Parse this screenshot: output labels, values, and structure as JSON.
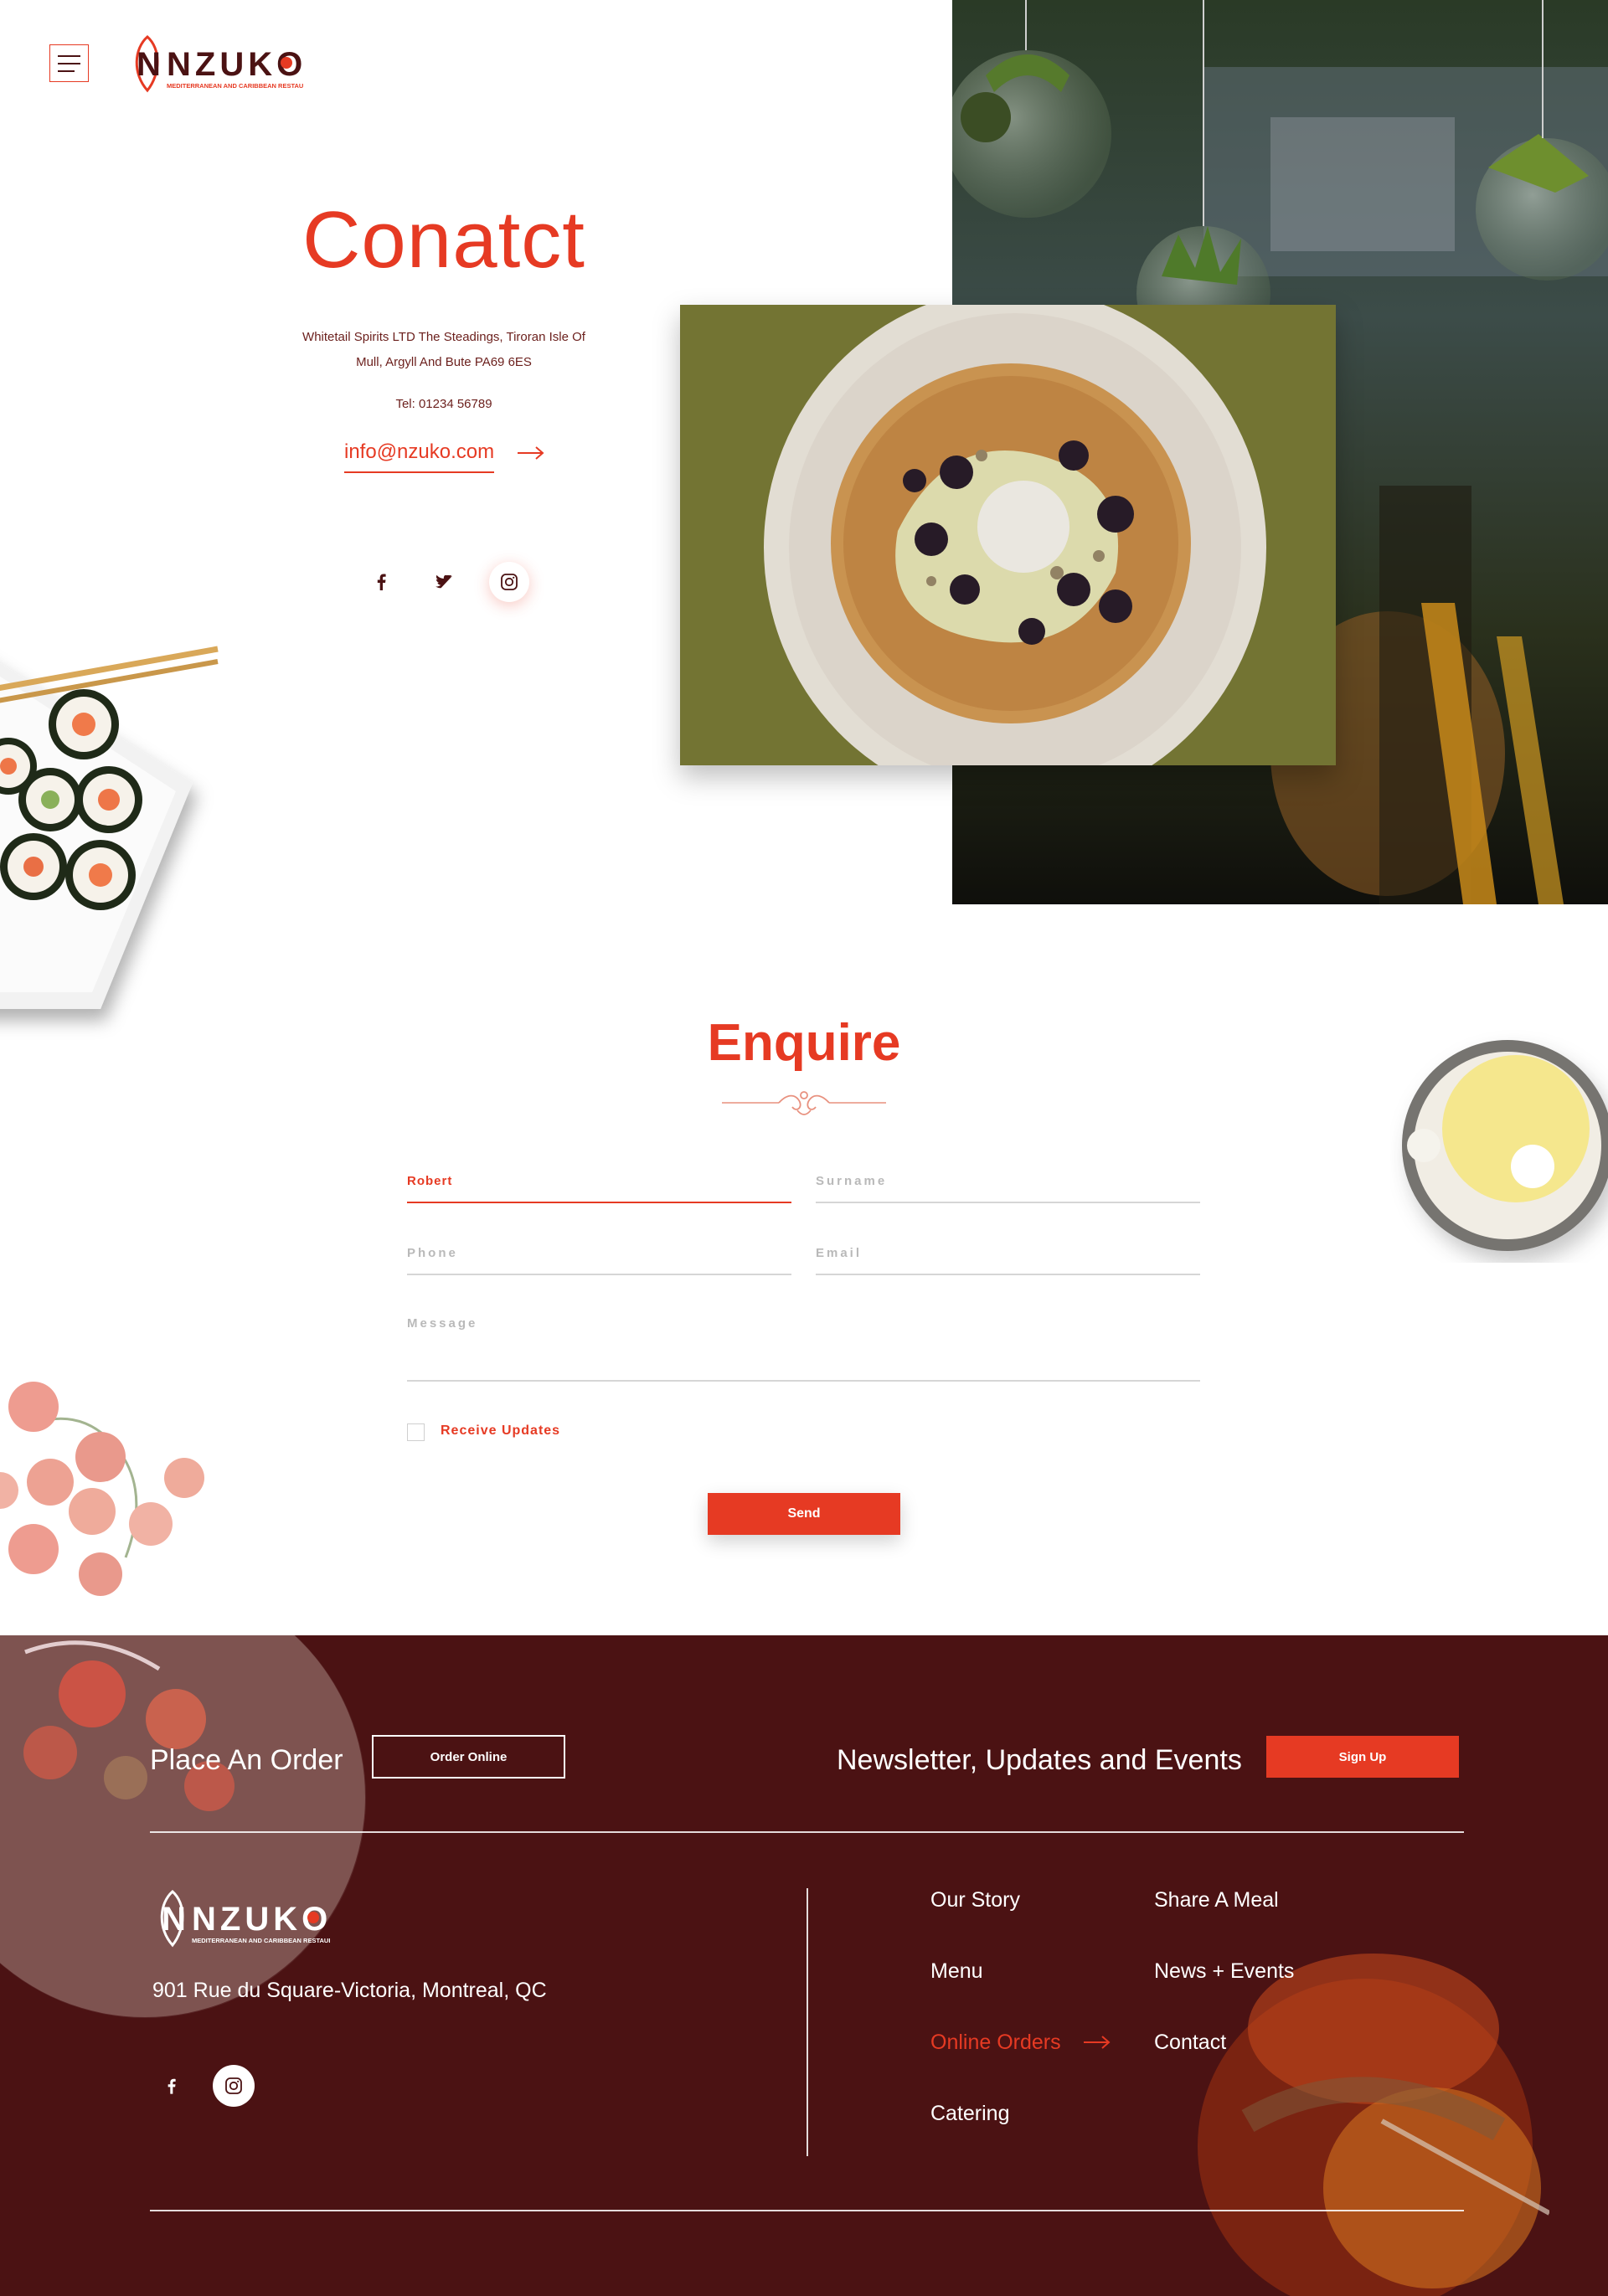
{
  "header": {
    "menu_icon": "hamburger-icon",
    "logo_text": "NZUKO",
    "logo_tagline": "MEDITERRANEAN AND CARIBBEAN RESTAURANT"
  },
  "contact": {
    "title": "Conatct",
    "address_line1": "Whitetail Spirits LTD The Steadings, Tiroran Isle Of",
    "address_line2": "Mull, Argyll And Bute PA69 6ES",
    "tel": "Tel: 01234 56789",
    "email": "info@nzuko.com",
    "socials": [
      "facebook-icon",
      "twitter-icon",
      "instagram-icon"
    ]
  },
  "enquire": {
    "title": "Enquire",
    "first_name_value": "Robert",
    "surname_placeholder": "Surname",
    "phone_placeholder": "Phone",
    "email_placeholder": "Email",
    "message_placeholder": "Message",
    "checkbox_label": "Receive Updates",
    "send_label": "Send"
  },
  "footer": {
    "order_title": "Place An Order",
    "order_button": "Order Online",
    "newsletter_title": "Newsletter, Updates and Events",
    "signup_button": "Sign Up",
    "logo_text": "NZUKO",
    "logo_tagline": "MEDITERRANEAN AND CARIBBEAN RESTAURANT",
    "address": "901 Rue du Square-Victoria, Montreal, QC",
    "nav": {
      "our_story": "Our Story",
      "share_a_meal": "Share A Meal",
      "menu": "Menu",
      "news_events": "News + Events",
      "online_orders": "Online Orders",
      "contact": "Contact",
      "catering": "Catering"
    }
  },
  "colors": {
    "accent": "#e63a23",
    "footer_bg": "#4b1213",
    "text_dark": "#6b1f1c"
  }
}
